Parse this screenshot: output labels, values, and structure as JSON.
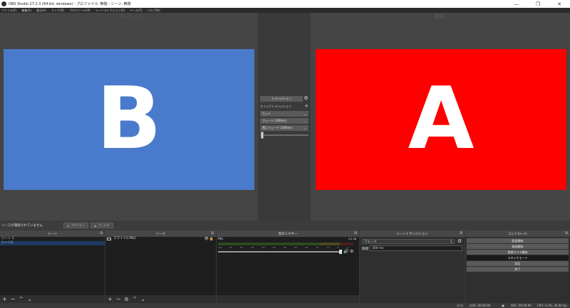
{
  "window": {
    "title": "OBS Studio 27.2.3 (64-bit, windows) - プロファイル: 無題 - シーン: 無題",
    "controls": [
      "—",
      "❐",
      "✕"
    ]
  },
  "menu": [
    "ファイル(F)",
    "編集(E)",
    "表示(V)",
    "ドック(D)",
    "プロファイル(P)",
    "シーンコレクション(S)",
    "ツール(T)",
    "ヘルプ(H)"
  ],
  "preview": {
    "label": "プレビュー",
    "letter": "B",
    "color": "#4a7acb"
  },
  "program": {
    "label": "番組",
    "letter": "A",
    "color": "#ff0000"
  },
  "transition_panel": {
    "transition_button": "トランジション",
    "quick_label": "クイックトランジション",
    "items": [
      "カット",
      "フェード (300ms)",
      "黒にフェード (300ms)"
    ]
  },
  "source_bar": {
    "message": "ソースが選択されていません",
    "properties": "プロパティ",
    "filters": "フィルタ"
  },
  "docks": {
    "scenes": {
      "title": "シーン",
      "items": [
        "シーン 1",
        "シーン2"
      ]
    },
    "sources": {
      "title": "ソース",
      "items": [
        "スライド2.PNG"
      ]
    },
    "mixer": {
      "title": "音声ミキサー",
      "channel": "Mic",
      "level": "0.0 dB",
      "scale": [
        "-60",
        "-55",
        "-50",
        "-45",
        "-40",
        "-35",
        "-30",
        "-25",
        "-20",
        "-15",
        "-10",
        "-5",
        "0"
      ]
    },
    "transitions": {
      "title": "シーントランジション",
      "selected": "フェード",
      "duration_label": "期間",
      "duration_value": "300 ms"
    },
    "controls": {
      "title": "コントロール",
      "buttons": [
        "配信開始",
        "録画開始",
        "仮想カメラ開始",
        "スタジオモード",
        "設定",
        "終了"
      ]
    }
  },
  "status": {
    "live": "LIVE: 00:00:00",
    "rec": "REC: 00:00:00",
    "cpu": "CPU: 4.2%, 30.00 fps"
  }
}
